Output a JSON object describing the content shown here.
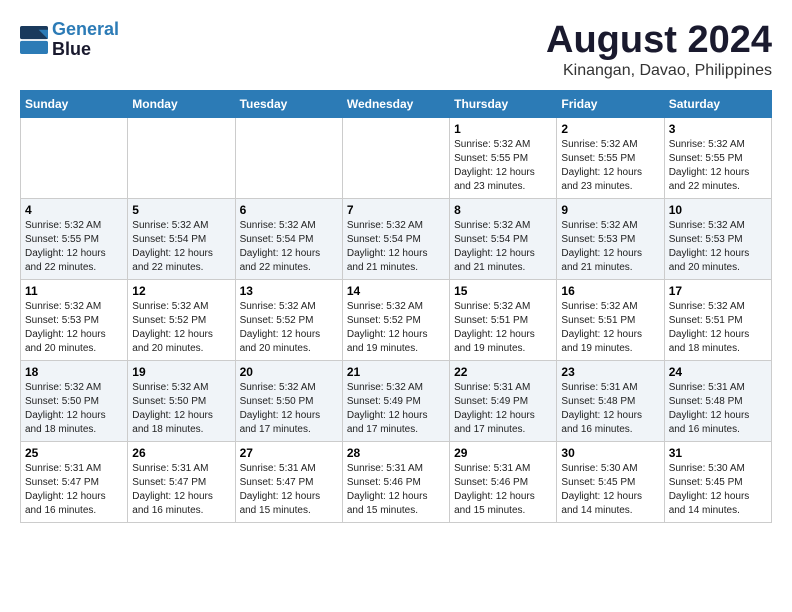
{
  "logo": {
    "line1": "General",
    "line2": "Blue"
  },
  "title": "August 2024",
  "subtitle": "Kinangan, Davao, Philippines",
  "days_of_week": [
    "Sunday",
    "Monday",
    "Tuesday",
    "Wednesday",
    "Thursday",
    "Friday",
    "Saturday"
  ],
  "weeks": [
    [
      {
        "day": "",
        "info": ""
      },
      {
        "day": "",
        "info": ""
      },
      {
        "day": "",
        "info": ""
      },
      {
        "day": "",
        "info": ""
      },
      {
        "day": "1",
        "info": "Sunrise: 5:32 AM\nSunset: 5:55 PM\nDaylight: 12 hours\nand 23 minutes."
      },
      {
        "day": "2",
        "info": "Sunrise: 5:32 AM\nSunset: 5:55 PM\nDaylight: 12 hours\nand 23 minutes."
      },
      {
        "day": "3",
        "info": "Sunrise: 5:32 AM\nSunset: 5:55 PM\nDaylight: 12 hours\nand 22 minutes."
      }
    ],
    [
      {
        "day": "4",
        "info": "Sunrise: 5:32 AM\nSunset: 5:55 PM\nDaylight: 12 hours\nand 22 minutes."
      },
      {
        "day": "5",
        "info": "Sunrise: 5:32 AM\nSunset: 5:54 PM\nDaylight: 12 hours\nand 22 minutes."
      },
      {
        "day": "6",
        "info": "Sunrise: 5:32 AM\nSunset: 5:54 PM\nDaylight: 12 hours\nand 22 minutes."
      },
      {
        "day": "7",
        "info": "Sunrise: 5:32 AM\nSunset: 5:54 PM\nDaylight: 12 hours\nand 21 minutes."
      },
      {
        "day": "8",
        "info": "Sunrise: 5:32 AM\nSunset: 5:54 PM\nDaylight: 12 hours\nand 21 minutes."
      },
      {
        "day": "9",
        "info": "Sunrise: 5:32 AM\nSunset: 5:53 PM\nDaylight: 12 hours\nand 21 minutes."
      },
      {
        "day": "10",
        "info": "Sunrise: 5:32 AM\nSunset: 5:53 PM\nDaylight: 12 hours\nand 20 minutes."
      }
    ],
    [
      {
        "day": "11",
        "info": "Sunrise: 5:32 AM\nSunset: 5:53 PM\nDaylight: 12 hours\nand 20 minutes."
      },
      {
        "day": "12",
        "info": "Sunrise: 5:32 AM\nSunset: 5:52 PM\nDaylight: 12 hours\nand 20 minutes."
      },
      {
        "day": "13",
        "info": "Sunrise: 5:32 AM\nSunset: 5:52 PM\nDaylight: 12 hours\nand 20 minutes."
      },
      {
        "day": "14",
        "info": "Sunrise: 5:32 AM\nSunset: 5:52 PM\nDaylight: 12 hours\nand 19 minutes."
      },
      {
        "day": "15",
        "info": "Sunrise: 5:32 AM\nSunset: 5:51 PM\nDaylight: 12 hours\nand 19 minutes."
      },
      {
        "day": "16",
        "info": "Sunrise: 5:32 AM\nSunset: 5:51 PM\nDaylight: 12 hours\nand 19 minutes."
      },
      {
        "day": "17",
        "info": "Sunrise: 5:32 AM\nSunset: 5:51 PM\nDaylight: 12 hours\nand 18 minutes."
      }
    ],
    [
      {
        "day": "18",
        "info": "Sunrise: 5:32 AM\nSunset: 5:50 PM\nDaylight: 12 hours\nand 18 minutes."
      },
      {
        "day": "19",
        "info": "Sunrise: 5:32 AM\nSunset: 5:50 PM\nDaylight: 12 hours\nand 18 minutes."
      },
      {
        "day": "20",
        "info": "Sunrise: 5:32 AM\nSunset: 5:50 PM\nDaylight: 12 hours\nand 17 minutes."
      },
      {
        "day": "21",
        "info": "Sunrise: 5:32 AM\nSunset: 5:49 PM\nDaylight: 12 hours\nand 17 minutes."
      },
      {
        "day": "22",
        "info": "Sunrise: 5:31 AM\nSunset: 5:49 PM\nDaylight: 12 hours\nand 17 minutes."
      },
      {
        "day": "23",
        "info": "Sunrise: 5:31 AM\nSunset: 5:48 PM\nDaylight: 12 hours\nand 16 minutes."
      },
      {
        "day": "24",
        "info": "Sunrise: 5:31 AM\nSunset: 5:48 PM\nDaylight: 12 hours\nand 16 minutes."
      }
    ],
    [
      {
        "day": "25",
        "info": "Sunrise: 5:31 AM\nSunset: 5:47 PM\nDaylight: 12 hours\nand 16 minutes."
      },
      {
        "day": "26",
        "info": "Sunrise: 5:31 AM\nSunset: 5:47 PM\nDaylight: 12 hours\nand 16 minutes."
      },
      {
        "day": "27",
        "info": "Sunrise: 5:31 AM\nSunset: 5:47 PM\nDaylight: 12 hours\nand 15 minutes."
      },
      {
        "day": "28",
        "info": "Sunrise: 5:31 AM\nSunset: 5:46 PM\nDaylight: 12 hours\nand 15 minutes."
      },
      {
        "day": "29",
        "info": "Sunrise: 5:31 AM\nSunset: 5:46 PM\nDaylight: 12 hours\nand 15 minutes."
      },
      {
        "day": "30",
        "info": "Sunrise: 5:30 AM\nSunset: 5:45 PM\nDaylight: 12 hours\nand 14 minutes."
      },
      {
        "day": "31",
        "info": "Sunrise: 5:30 AM\nSunset: 5:45 PM\nDaylight: 12 hours\nand 14 minutes."
      }
    ]
  ]
}
